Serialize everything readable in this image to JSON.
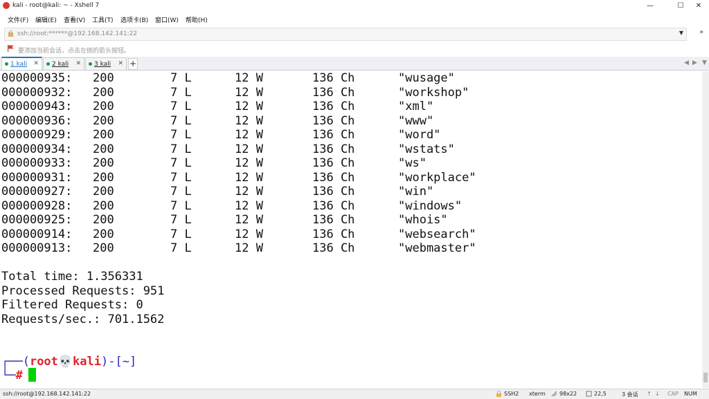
{
  "window": {
    "title": "kali - root@kali: ~ - Xshell 7",
    "minimize": "—",
    "maximize": "☐",
    "close": "✕"
  },
  "menu": [
    "文件(F)",
    "编辑(E)",
    "查看(V)",
    "工具(T)",
    "选项卡(B)",
    "窗口(W)",
    "帮助(H)"
  ],
  "address": {
    "value": "ssh://root:******@192.168.142.141:22",
    "more": "»"
  },
  "hint": "要添加当前会话，点击左侧的箭头按钮。",
  "tabs": [
    {
      "label": "1 kali",
      "close": "✕"
    },
    {
      "label": "2 kali",
      "close": "✕"
    },
    {
      "label": "3 kali",
      "close": "✕"
    }
  ],
  "tab_add": "+",
  "terminal": {
    "rows": [
      [
        "000000935:",
        "200",
        "7 L",
        "12 W",
        "136 Ch",
        "\"wusage\""
      ],
      [
        "000000932:",
        "200",
        "7 L",
        "12 W",
        "136 Ch",
        "\"workshop\""
      ],
      [
        "000000943:",
        "200",
        "7 L",
        "12 W",
        "136 Ch",
        "\"xml\""
      ],
      [
        "000000936:",
        "200",
        "7 L",
        "12 W",
        "136 Ch",
        "\"www\""
      ],
      [
        "000000929:",
        "200",
        "7 L",
        "12 W",
        "136 Ch",
        "\"word\""
      ],
      [
        "000000934:",
        "200",
        "7 L",
        "12 W",
        "136 Ch",
        "\"wstats\""
      ],
      [
        "000000933:",
        "200",
        "7 L",
        "12 W",
        "136 Ch",
        "\"ws\""
      ],
      [
        "000000931:",
        "200",
        "7 L",
        "12 W",
        "136 Ch",
        "\"workplace\""
      ],
      [
        "000000927:",
        "200",
        "7 L",
        "12 W",
        "136 Ch",
        "\"win\""
      ],
      [
        "000000928:",
        "200",
        "7 L",
        "12 W",
        "136 Ch",
        "\"windows\""
      ],
      [
        "000000925:",
        "200",
        "7 L",
        "12 W",
        "136 Ch",
        "\"whois\""
      ],
      [
        "000000914:",
        "200",
        "7 L",
        "12 W",
        "136 Ch",
        "\"websearch\""
      ],
      [
        "000000913:",
        "200",
        "7 L",
        "12 W",
        "136 Ch",
        "\"webmaster\""
      ]
    ],
    "summary": [
      "Total time: 1.356331",
      "Processed Requests: 951",
      "Filtered Requests: 0",
      "Requests/sec.: 701.1562"
    ],
    "prompt_open": "┌──(",
    "prompt_user": "root💀kali",
    "prompt_close": ")-[~]",
    "prompt_hash_prefix": "└─",
    "prompt_hash": "#"
  },
  "status": {
    "connection": "ssh://root@192.168.142.141:22",
    "protocol": "SSH2",
    "term": "xterm",
    "size": "98x22",
    "pos": "22,5",
    "sessions": "3 会话",
    "caps": "CAP",
    "num": "NUM"
  },
  "colors": {
    "accent": "#1e73c8",
    "cursor": "#00d400",
    "prompt_user": "#e0232f",
    "prompt_frame": "#2a2ab0"
  }
}
